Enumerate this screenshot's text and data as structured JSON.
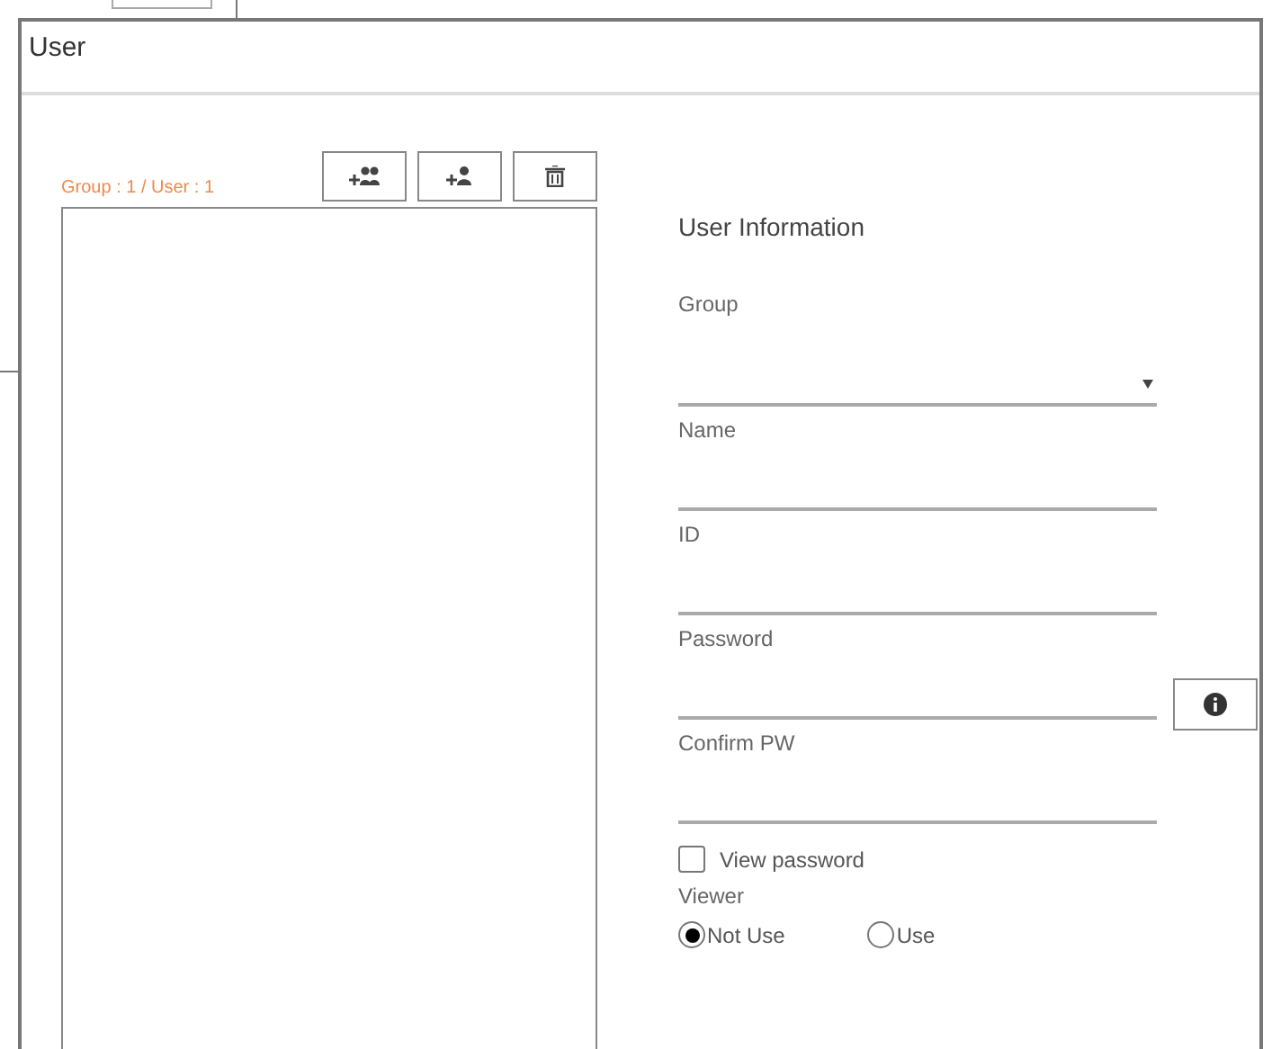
{
  "window": {
    "title": "User"
  },
  "user_list": {
    "count_label": "Group : 1 / User : 1"
  },
  "toolbar": [
    {
      "kind": "add-group"
    },
    {
      "kind": "add-user"
    },
    {
      "kind": "delete"
    }
  ],
  "user_information": {
    "title": "User Information",
    "fields": [
      {
        "label": "Group",
        "kind": "select"
      },
      {
        "label": "Name",
        "kind": "text"
      },
      {
        "label": "ID",
        "kind": "text"
      },
      {
        "label": "Password",
        "kind": "password"
      },
      {
        "label": "Confirm PW",
        "kind": "text"
      }
    ],
    "view_password": {
      "label": "View password",
      "checked": false
    },
    "viewer": {
      "label": "Viewer",
      "options": [
        {
          "label": "Not Use",
          "selected": true
        },
        {
          "label": "Use",
          "selected": false
        }
      ]
    }
  }
}
